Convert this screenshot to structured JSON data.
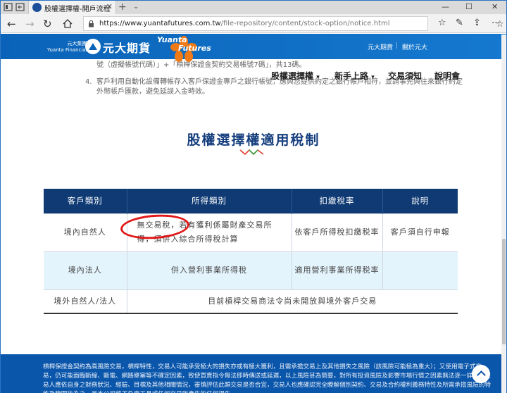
{
  "browser": {
    "tab_title": "股權選擇權-開戶流程",
    "tab_close": "✕",
    "new_tab": "+",
    "tab_menu": "⌄",
    "window_controls": {
      "minimize": "—",
      "maximize": "☐",
      "close": "✕"
    },
    "url_host": "https://www.yuantafutures.com.tw",
    "url_path": "/file-repository/content/stock-option/notice.html"
  },
  "header": {
    "logo_small": "元大集團\nYuanta Financial",
    "logo_text": "元大期貨",
    "brand_line1": "Yuanta",
    "brand_line2": "Futures",
    "links": [
      "元大期貨",
      "關於元大"
    ],
    "separator": "|"
  },
  "notice": {
    "line_top": "號（虛擬帳號代碼）」+「槓桿保證金契約交易帳號7碼」，共13碼。",
    "item_num": "4.",
    "item_text": "客戶利用自動化設備轉帳存入客戶保證金專戶之銀行帳號，應與您提供約定之銀行帳戶相符，並請事先與往來銀行約定外幣帳戶匯款，避免延誤入金時效。"
  },
  "nav": {
    "items": [
      "股權選擇權",
      "新手上路",
      "交易須知",
      "說明會"
    ],
    "caret": "▾"
  },
  "section": {
    "title": "股權選擇權適用稅制"
  },
  "table": {
    "headers": [
      "客戶類別",
      "所得類別",
      "扣繳稅率",
      "說明"
    ],
    "rows": [
      [
        "境內自然人",
        "無交易稅，若有獲利係屬財產交易所得，須併入綜合所得稅計算",
        "依客戶所得稅扣繳税率",
        "客戶須自行申報"
      ],
      [
        "境內法人",
        "併入營利事業所得稅",
        "適用營利事業所得税率",
        ""
      ],
      [
        "境外自然人/法人",
        "目前槓桿交易商法令尚未開放與境外客戶交易"
      ]
    ]
  },
  "footer": {
    "text": "槓桿保證金契約為高風險交易，槓桿特性，交易人可能承受極大的損失亦或有極大獲利，且需承擔交易上及其他損失之風險（該風險可能極為重大）；又使用電子式交易，仍可能面臨斷線、斷電、網路壅塞等不確定因素，致使買賣指令無法即時傳送或延遲，以上風險甚為簡要，對所有投資風險及影響市場行情之因素無法逐一詳述，交易人應依自身之財務狀況、經驗、目標及其他相關情況，審慎評估此類交易是否合宜，交易人也應確認完全瞭解個別契約、交易及合約權利義務特性及所需承擔風險的特性及範圍後為之，且本公司將不負責工具或任何交易所產生的任何損失。"
  },
  "colors": {
    "brand_blue": "#0a63b8",
    "table_header": "#0f3a73",
    "title_blue": "#153e7e",
    "annotation_red": "#e01818",
    "row_highlight": "#e4f4fc"
  }
}
